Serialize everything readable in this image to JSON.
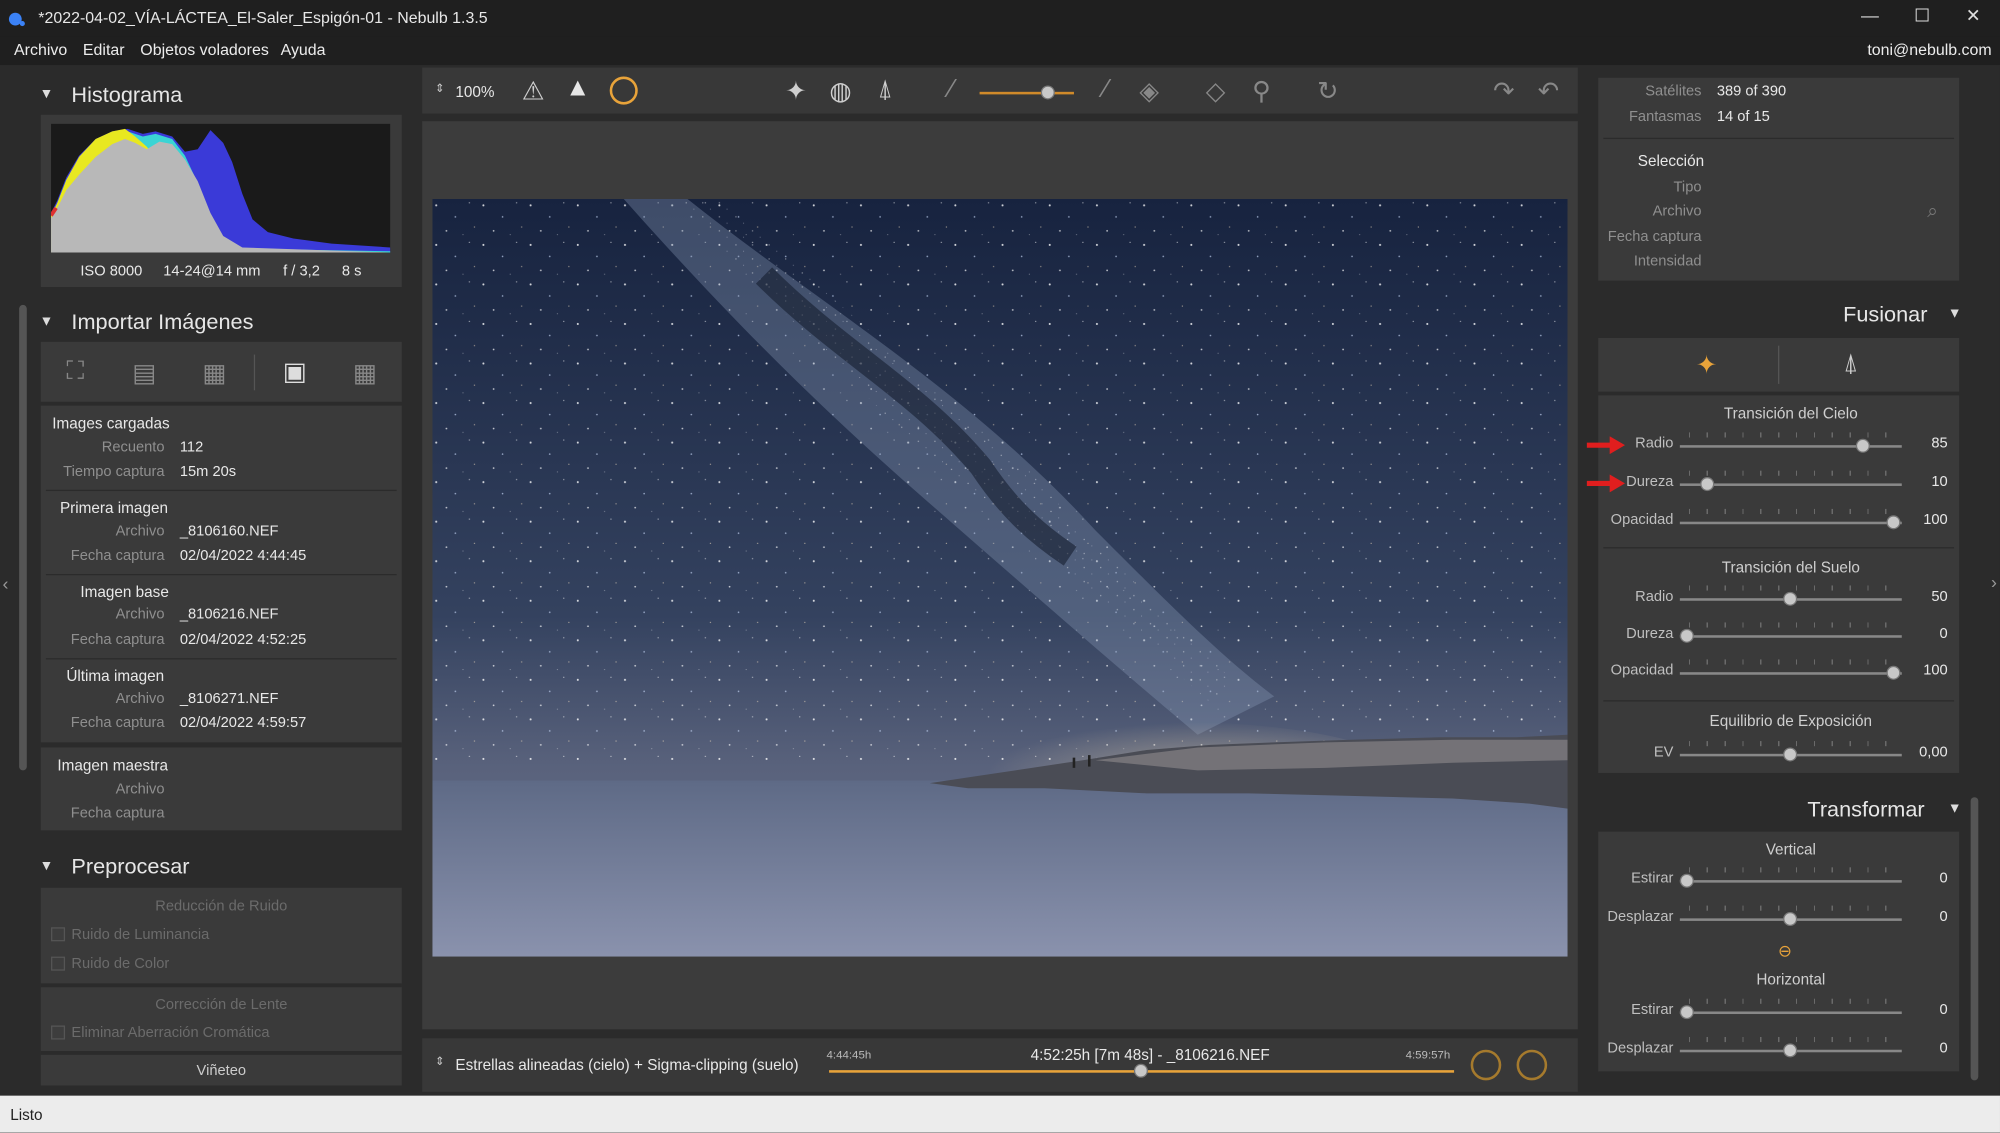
{
  "window": {
    "title": "*2022-04-02_VÍA-LÁCTEA_El-Saler_Espigón-01 - Nebulb 1.3.5",
    "minimize": "—",
    "maximize": "☐",
    "close": "✕"
  },
  "menu": {
    "items": [
      "Archivo",
      "Editar",
      "Objetos voladores",
      "Ayuda"
    ],
    "user": "toni@nebulb.com"
  },
  "histogram": {
    "title": "Histograma",
    "iso": "ISO 8000",
    "lens": "14-24@14 mm",
    "aperture": "f / 3,2",
    "shutter": "8 s"
  },
  "import": {
    "title": "Importar Imágenes",
    "loaded": {
      "header": "Images cargadas",
      "count_label": "Recuento",
      "count": "112",
      "time_label": "Tiempo captura",
      "time": "15m 20s"
    },
    "first": {
      "header": "Primera imagen",
      "file_label": "Archivo",
      "file": "_8106160.NEF",
      "date_label": "Fecha captura",
      "date": "02/04/2022 4:44:45"
    },
    "base": {
      "header": "Imagen base",
      "file_label": "Archivo",
      "file": "_8106216.NEF",
      "date_label": "Fecha captura",
      "date": "02/04/2022 4:52:25"
    },
    "last": {
      "header": "Última imagen",
      "file_label": "Archivo",
      "file": "_8106271.NEF",
      "date_label": "Fecha captura",
      "date": "02/04/2022 4:59:57"
    },
    "master": {
      "header": "Imagen maestra",
      "file_label": "Archivo",
      "date_label": "Fecha captura"
    }
  },
  "preprocess": {
    "title": "Preprocesar",
    "noise_header": "Reducción de Ruido",
    "luminance": "Ruido de Luminancia",
    "color": "Ruido de Color",
    "lens_header": "Corrección de Lente",
    "chromatic": "Eliminar Aberración Cromática",
    "vignetting": "Viñeteo"
  },
  "toolbar": {
    "zoom": "100%"
  },
  "statusbar": {
    "mode": "Estrellas alineadas (cielo) + Sigma-clipping (suelo)",
    "start_time": "4:44:45h",
    "current": "4:52:25h [7m 48s] - _8106216.NEF",
    "end_time": "4:59:57h",
    "timeline_position": 0.5
  },
  "status": "Listo",
  "info": {
    "satellites_label": "Satélites",
    "satellites": "389 of 390",
    "ghosts_label": "Fantasmas",
    "ghosts": "14 of 15",
    "selection_header": "Selección",
    "type_label": "Tipo",
    "file_label": "Archivo",
    "date_label": "Fecha captura",
    "intensity_label": "Intensidad"
  },
  "fusionar": {
    "title": "Fusionar",
    "sky_header": "Transición del Cielo",
    "sky": [
      {
        "label": "Radio",
        "value": "85",
        "pos": 0.85
      },
      {
        "label": "Dureza",
        "value": "10",
        "pos": 0.1
      },
      {
        "label": "Opacidad",
        "value": "100",
        "pos": 1.0
      }
    ],
    "ground_header": "Transición del Suelo",
    "ground": [
      {
        "label": "Radio",
        "value": "50",
        "pos": 0.5
      },
      {
        "label": "Dureza",
        "value": "0",
        "pos": 0.0
      },
      {
        "label": "Opacidad",
        "value": "100",
        "pos": 1.0
      }
    ],
    "exposure_header": "Equilibrio de Exposición",
    "ev_label": "EV",
    "ev_value": "0,00",
    "ev_pos": 0.5
  },
  "transformar": {
    "title": "Transformar",
    "vertical_header": "Vertical",
    "vertical": [
      {
        "label": "Estirar",
        "value": "0",
        "pos": 0.0
      },
      {
        "label": "Desplazar",
        "value": "0",
        "pos": 0.5
      }
    ],
    "horizontal_header": "Horizontal",
    "horizontal": [
      {
        "label": "Estirar",
        "value": "0",
        "pos": 0.0
      },
      {
        "label": "Desplazar",
        "value": "0",
        "pos": 0.5
      }
    ]
  },
  "colors": {
    "accent": "#e8a33a",
    "arrow": "#e01e1e"
  }
}
